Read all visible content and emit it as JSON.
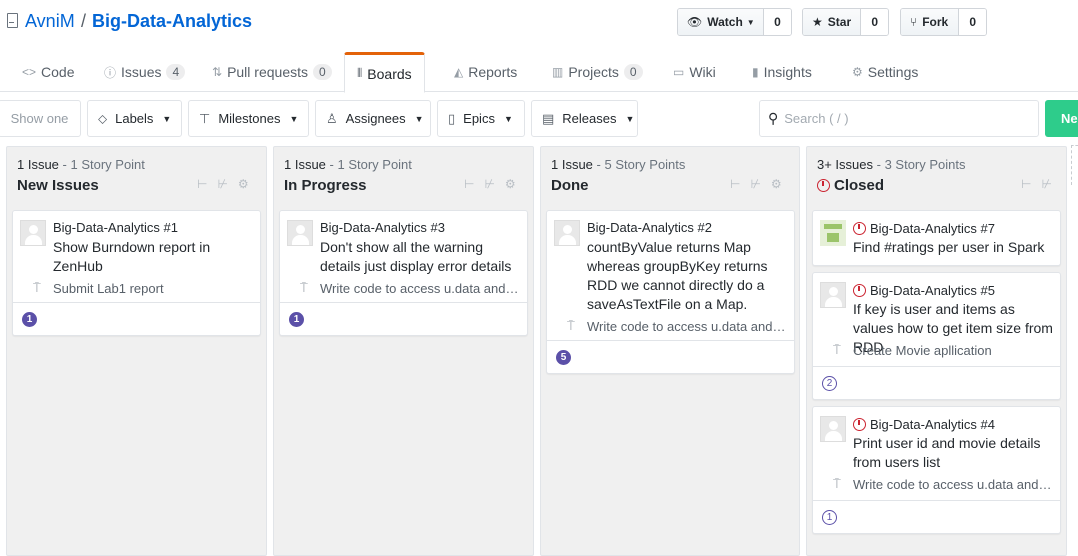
{
  "repo": {
    "owner": "AvniM",
    "separator": "/",
    "name": "Big-Data-Analytics"
  },
  "actions": {
    "watch": {
      "label": "Watch",
      "count": "0"
    },
    "star": {
      "label": "Star",
      "count": "0"
    },
    "fork": {
      "label": "Fork",
      "count": "0"
    }
  },
  "tabs": {
    "code": {
      "label": "Code"
    },
    "issues": {
      "label": "Issues",
      "count": "4"
    },
    "pulls": {
      "label": "Pull requests",
      "count": "0"
    },
    "boards": {
      "label": "Boards"
    },
    "reports": {
      "label": "Reports"
    },
    "projects": {
      "label": "Projects",
      "count": "0"
    },
    "wiki": {
      "label": "Wiki"
    },
    "insights": {
      "label": "Insights"
    },
    "settings": {
      "label": "Settings"
    }
  },
  "toolbar": {
    "show_one": "Show one",
    "labels": "Labels",
    "milestones": "Milestones",
    "assignees": "Assignees",
    "epics": "Epics",
    "releases": "Releases",
    "search_placeholder": "Search ( / )",
    "new_label": "Ne"
  },
  "pipelines": [
    {
      "count": "1 Issue",
      "points": " - 1 Story Point",
      "name": "New Issues",
      "cards": [
        {
          "ref": "Big-Data-Analytics #1",
          "title": "Show Burndown report in ZenHub",
          "epic": "Submit Lab1 report",
          "estimate": "1"
        }
      ]
    },
    {
      "count": "1 Issue",
      "points": " - 1 Story Point",
      "name": "In Progress",
      "cards": [
        {
          "ref": "Big-Data-Analytics #3",
          "title": "Don't show all the warning details just display error details",
          "epic": "Write code to access u.data and f...",
          "estimate": "1"
        }
      ]
    },
    {
      "count": "1 Issue",
      "points": " - 5 Story Points",
      "name": "Done",
      "cards": [
        {
          "ref": "Big-Data-Analytics #2",
          "title": "countByValue returns Map whereas groupByKey returns RDD we cannot directly do a saveAsTextFile on a Map.",
          "epic": "Write code to access u.data and f...",
          "estimate": "5"
        }
      ]
    },
    {
      "count": "3+ Issues",
      "points": " - 3 Story Points",
      "name": "Closed",
      "cards": [
        {
          "ref": "Big-Data-Analytics #7",
          "title": "Find #ratings per user in Spark"
        },
        {
          "ref": "Big-Data-Analytics #5",
          "title": "If key is user and items as values how to get item size from RDD",
          "epic": "Create Movie apllication",
          "estimate": "2"
        },
        {
          "ref": "Big-Data-Analytics #4",
          "title": "Print user id and movie details from users list",
          "epic": "Write code to access u.data and f...",
          "estimate": "1"
        }
      ]
    }
  ]
}
